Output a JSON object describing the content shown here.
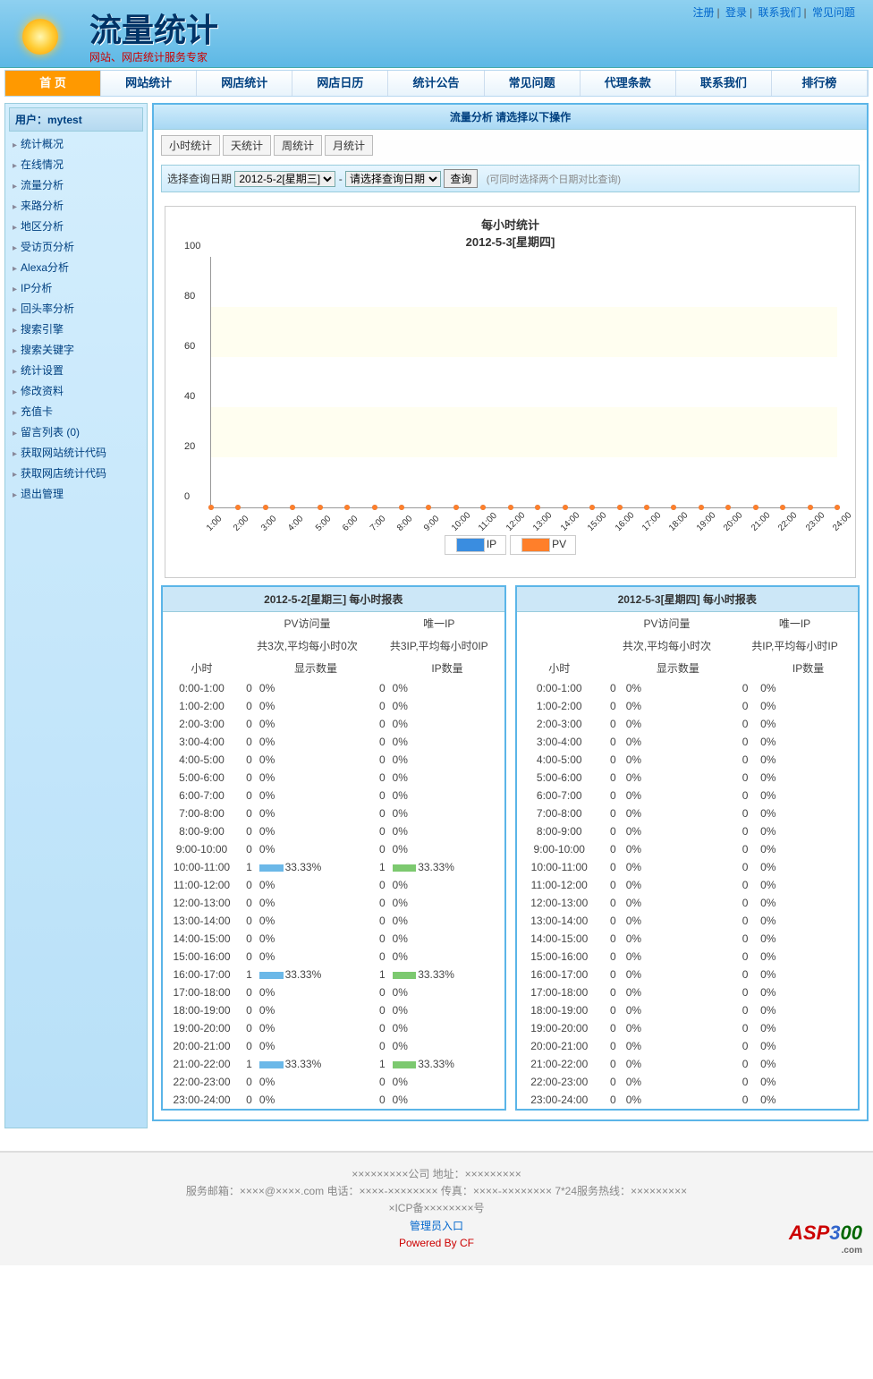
{
  "top_links": [
    "注册",
    "登录",
    "联系我们",
    "常见问题"
  ],
  "logo": {
    "main": "流量统计",
    "sub": "网站、网店统计服务专家"
  },
  "nav": [
    "首 页",
    "网站统计",
    "网店统计",
    "网店日历",
    "统计公告",
    "常见问题",
    "代理条款",
    "联系我们",
    "排行榜"
  ],
  "nav_active": 0,
  "sidebar": {
    "header": "用户：mytest",
    "items": [
      "统计概况",
      "在线情况",
      "流量分析",
      "来路分析",
      "地区分析",
      "受访页分析",
      "Alexa分析",
      "IP分析",
      "回头率分析",
      "搜索引擎",
      "搜索关键字",
      "统计设置",
      "修改资料",
      "充值卡",
      "留言列表  (0)",
      "获取网站统计代码",
      "获取网店统计代码",
      "退出管理"
    ]
  },
  "panel": {
    "title": "流量分析  请选择以下操作",
    "tabs": [
      "小时统计",
      "天统计",
      "周统计",
      "月统计"
    ],
    "query": {
      "label": "选择查询日期",
      "d1": "2012-5-2[星期三]",
      "d2": "请选择查询日期",
      "btn": "查询",
      "hint": "(可同时选择两个日期对比查询)"
    }
  },
  "chart_data": {
    "type": "line",
    "title": "每小时统计\n2012-5-3[星期四]",
    "xlabel": "",
    "ylabel": "",
    "ylim": [
      0,
      100
    ],
    "yticks": [
      0,
      20,
      40,
      60,
      80,
      100
    ],
    "categories": [
      "1:00",
      "2:00",
      "3:00",
      "4:00",
      "5:00",
      "6:00",
      "7:00",
      "8:00",
      "9:00",
      "10:00",
      "11:00",
      "12:00",
      "13:00",
      "14:00",
      "15:00",
      "16:00",
      "17:00",
      "18:00",
      "19:00",
      "20:00",
      "21:00",
      "22:00",
      "23:00",
      "24:00"
    ],
    "series": [
      {
        "name": "IP",
        "color": "#3a8de0",
        "values": [
          0,
          0,
          0,
          0,
          0,
          0,
          0,
          0,
          0,
          0,
          0,
          0,
          0,
          0,
          0,
          0,
          0,
          0,
          0,
          0,
          0,
          0,
          0,
          0
        ]
      },
      {
        "name": "PV",
        "color": "#ff7f2a",
        "values": [
          0,
          0,
          0,
          0,
          0,
          0,
          0,
          0,
          0,
          0,
          0,
          0,
          0,
          0,
          0,
          0,
          0,
          0,
          0,
          0,
          0,
          0,
          0,
          0
        ]
      }
    ]
  },
  "tables": [
    {
      "title": "2012-5-2[星期三] 每小时报表",
      "sub": {
        "pv": "PV访问量",
        "ip": "唯一IP",
        "pvs": "共3次,平均每小时0次",
        "ips": "共3IP,平均每小时0IP"
      },
      "cols": [
        "小时",
        "",
        "显示数量",
        "",
        "IP数量"
      ],
      "rows": [
        [
          "0:00-1:00",
          "0",
          "0%",
          "0",
          "0%"
        ],
        [
          "1:00-2:00",
          "0",
          "0%",
          "0",
          "0%"
        ],
        [
          "2:00-3:00",
          "0",
          "0%",
          "0",
          "0%"
        ],
        [
          "3:00-4:00",
          "0",
          "0%",
          "0",
          "0%"
        ],
        [
          "4:00-5:00",
          "0",
          "0%",
          "0",
          "0%"
        ],
        [
          "5:00-6:00",
          "0",
          "0%",
          "0",
          "0%"
        ],
        [
          "6:00-7:00",
          "0",
          "0%",
          "0",
          "0%"
        ],
        [
          "7:00-8:00",
          "0",
          "0%",
          "0",
          "0%"
        ],
        [
          "8:00-9:00",
          "0",
          "0%",
          "0",
          "0%"
        ],
        [
          "9:00-10:00",
          "0",
          "0%",
          "0",
          "0%"
        ],
        [
          "10:00-11:00",
          "1",
          "33.33%",
          "1",
          "33.33%"
        ],
        [
          "11:00-12:00",
          "0",
          "0%",
          "0",
          "0%"
        ],
        [
          "12:00-13:00",
          "0",
          "0%",
          "0",
          "0%"
        ],
        [
          "13:00-14:00",
          "0",
          "0%",
          "0",
          "0%"
        ],
        [
          "14:00-15:00",
          "0",
          "0%",
          "0",
          "0%"
        ],
        [
          "15:00-16:00",
          "0",
          "0%",
          "0",
          "0%"
        ],
        [
          "16:00-17:00",
          "1",
          "33.33%",
          "1",
          "33.33%"
        ],
        [
          "17:00-18:00",
          "0",
          "0%",
          "0",
          "0%"
        ],
        [
          "18:00-19:00",
          "0",
          "0%",
          "0",
          "0%"
        ],
        [
          "19:00-20:00",
          "0",
          "0%",
          "0",
          "0%"
        ],
        [
          "20:00-21:00",
          "0",
          "0%",
          "0",
          "0%"
        ],
        [
          "21:00-22:00",
          "1",
          "33.33%",
          "1",
          "33.33%"
        ],
        [
          "22:00-23:00",
          "0",
          "0%",
          "0",
          "0%"
        ],
        [
          "23:00-24:00",
          "0",
          "0%",
          "0",
          "0%"
        ]
      ]
    },
    {
      "title": "2012-5-3[星期四] 每小时报表",
      "sub": {
        "pv": "PV访问量",
        "ip": "唯一IP",
        "pvs": "共次,平均每小时次",
        "ips": "共IP,平均每小时IP"
      },
      "cols": [
        "小时",
        "",
        "显示数量",
        "",
        "IP数量"
      ],
      "rows": [
        [
          "0:00-1:00",
          "0",
          "0%",
          "0",
          "0%"
        ],
        [
          "1:00-2:00",
          "0",
          "0%",
          "0",
          "0%"
        ],
        [
          "2:00-3:00",
          "0",
          "0%",
          "0",
          "0%"
        ],
        [
          "3:00-4:00",
          "0",
          "0%",
          "0",
          "0%"
        ],
        [
          "4:00-5:00",
          "0",
          "0%",
          "0",
          "0%"
        ],
        [
          "5:00-6:00",
          "0",
          "0%",
          "0",
          "0%"
        ],
        [
          "6:00-7:00",
          "0",
          "0%",
          "0",
          "0%"
        ],
        [
          "7:00-8:00",
          "0",
          "0%",
          "0",
          "0%"
        ],
        [
          "8:00-9:00",
          "0",
          "0%",
          "0",
          "0%"
        ],
        [
          "9:00-10:00",
          "0",
          "0%",
          "0",
          "0%"
        ],
        [
          "10:00-11:00",
          "0",
          "0%",
          "0",
          "0%"
        ],
        [
          "11:00-12:00",
          "0",
          "0%",
          "0",
          "0%"
        ],
        [
          "12:00-13:00",
          "0",
          "0%",
          "0",
          "0%"
        ],
        [
          "13:00-14:00",
          "0",
          "0%",
          "0",
          "0%"
        ],
        [
          "14:00-15:00",
          "0",
          "0%",
          "0",
          "0%"
        ],
        [
          "15:00-16:00",
          "0",
          "0%",
          "0",
          "0%"
        ],
        [
          "16:00-17:00",
          "0",
          "0%",
          "0",
          "0%"
        ],
        [
          "17:00-18:00",
          "0",
          "0%",
          "0",
          "0%"
        ],
        [
          "18:00-19:00",
          "0",
          "0%",
          "0",
          "0%"
        ],
        [
          "19:00-20:00",
          "0",
          "0%",
          "0",
          "0%"
        ],
        [
          "20:00-21:00",
          "0",
          "0%",
          "0",
          "0%"
        ],
        [
          "21:00-22:00",
          "0",
          "0%",
          "0",
          "0%"
        ],
        [
          "22:00-23:00",
          "0",
          "0%",
          "0",
          "0%"
        ],
        [
          "23:00-24:00",
          "0",
          "0%",
          "0",
          "0%"
        ]
      ]
    }
  ],
  "footer": {
    "l1": "×××××××××公司  地址：×××××××××",
    "l2": "服务邮箱：××××@××××.com 电话：××××-×××××××× 传真：××××-×××××××× 7*24服务热线：×××××××××",
    "l3": "×ICP备××××××××号",
    "l4": "管理员入口",
    "l5": "Powered By CF"
  }
}
